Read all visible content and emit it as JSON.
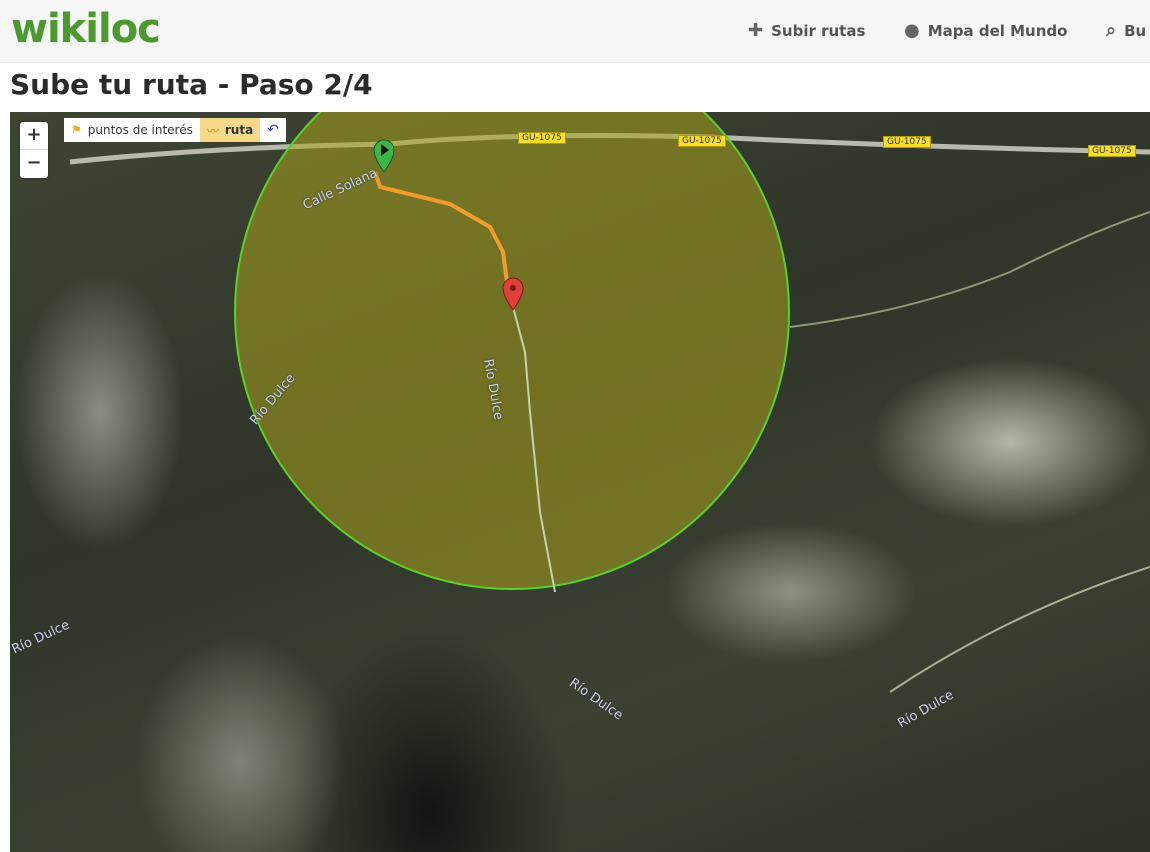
{
  "header": {
    "logo": "wikiloc",
    "nav": [
      {
        "icon": "plus-icon",
        "label": "Subir rutas"
      },
      {
        "icon": "globe-icon",
        "label": "Mapa del Mundo"
      },
      {
        "icon": "search-icon",
        "label": "Bu"
      }
    ]
  },
  "page": {
    "title": "Sube tu ruta - Paso 2/4"
  },
  "map": {
    "zoom_in": "+",
    "zoom_out": "−",
    "toolbar": {
      "poi_label": "puntos de interés",
      "route_label": "ruta"
    },
    "road_labels": [
      "GU-1075",
      "GU-1075",
      "GU-1075",
      "GU-1075"
    ],
    "street_labels": [
      "Calle Solana",
      "Río Dulce",
      "Río Dulce",
      "Río Dulce",
      "Río Dulce",
      "Río Dulce"
    ],
    "colors": {
      "circle": "#58d12a",
      "route": "#f29d2a",
      "start_marker": "#3bb54a",
      "end_marker": "#e0403a"
    }
  }
}
